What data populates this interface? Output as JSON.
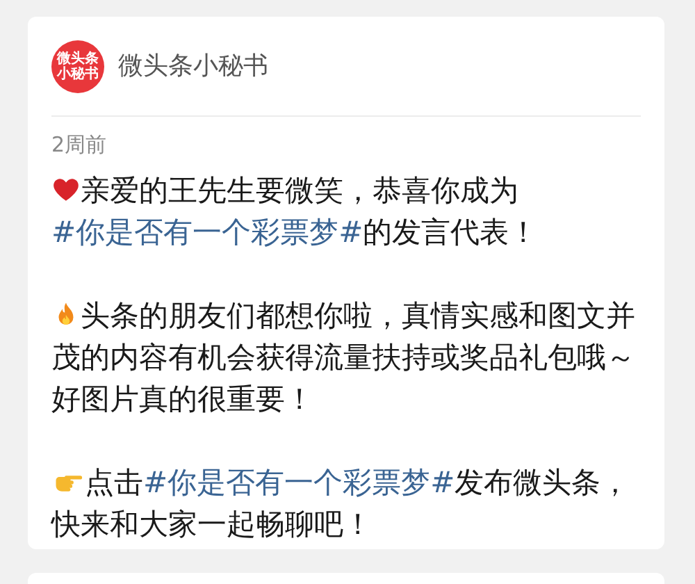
{
  "post": {
    "author": {
      "avatar_lines": [
        "微头条",
        "小秘书"
      ],
      "name": "微头条小秘书"
    },
    "time": "2周前",
    "paragraphs": [
      {
        "segments": [
          {
            "kind": "text",
            "text": "亲爱的王先生要微笑，恭喜你成为"
          },
          {
            "kind": "hashtag",
            "text": "#你是否有一个彩票梦#"
          },
          {
            "kind": "text",
            "text": "的发言代表！"
          }
        ]
      },
      {
        "segments": [
          {
            "kind": "text",
            "text": "头条的朋友们都想你啦，真情实感和图文并茂的内容有机会获得流量扶持或奖品礼包哦～好图片真的很重要！"
          }
        ]
      },
      {
        "segments": [
          {
            "kind": "text",
            "text": "点击"
          },
          {
            "kind": "hashtag",
            "text": "#你是否有一个彩票梦#"
          },
          {
            "kind": "text",
            "text": "发布微头条，快来和大家一起畅聊吧！"
          }
        ]
      }
    ]
  }
}
